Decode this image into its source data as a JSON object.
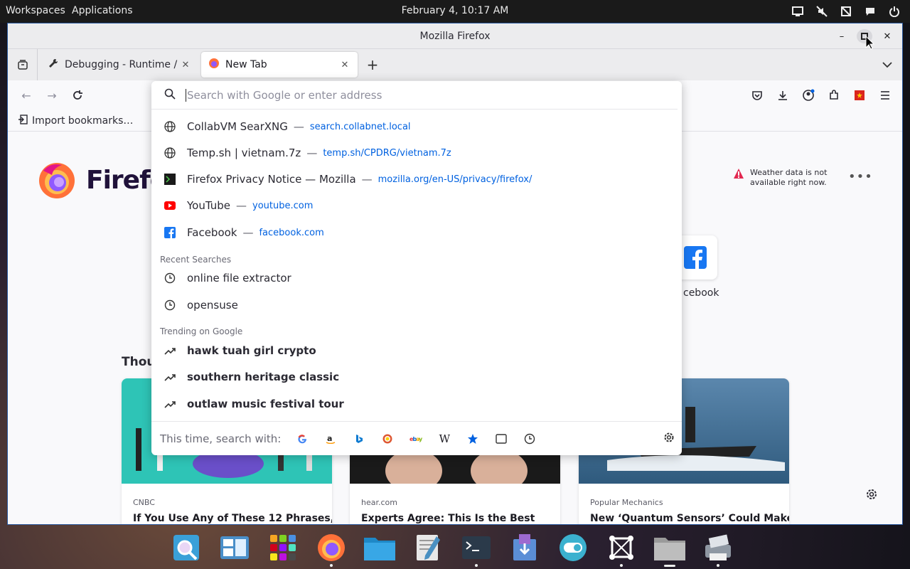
{
  "top_panel": {
    "workspaces": "Workspaces",
    "applications": "Applications",
    "clock": "February 4, 10:17 AM",
    "tray_icons": [
      "display-icon",
      "mute-icon",
      "network-off-icon",
      "chat-icon",
      "power-icon"
    ]
  },
  "window": {
    "title": "Mozilla Firefox",
    "controls": [
      "minimize",
      "maximize",
      "close"
    ]
  },
  "tabs": [
    {
      "label": "Debugging - Runtime / this-firefox",
      "icon": "wrench-icon",
      "active": false
    },
    {
      "label": "New Tab",
      "icon": "firefox-icon",
      "active": true
    }
  ],
  "navbar": {
    "url_placeholder": "Search with Google or enter address",
    "toolbar_icons": [
      "pocket-icon",
      "download-icon",
      "account-icon",
      "extensions-icon",
      "flag-icon",
      "menu-icon"
    ]
  },
  "bookmarks": {
    "import_label": "Import bookmarks…"
  },
  "newtab": {
    "brand": "Firefox",
    "weather_message": "Weather data is not available right now.",
    "shortcut_label": "cebook",
    "stories_heading": "Thou",
    "cards": [
      {
        "source": "CNBC",
        "headline": "If You Use Any of These 12 Phrases,",
        "color": "#2ec4b6"
      },
      {
        "source": "hear.com",
        "headline": "Experts Agree: This Is the Best",
        "color": "#1a1a1a"
      },
      {
        "source": "Popular Mechanics",
        "headline": "New ‘Quantum Sensors’ Could Make",
        "color": "#3f6e94"
      }
    ]
  },
  "suggestions": {
    "sites": [
      {
        "title": "CollabVM SearXNG",
        "url": "search.collabnet.local",
        "icon": "globe-icon"
      },
      {
        "title": "Temp.sh | vietnam.7z",
        "url": "temp.sh/CPDRG/vietnam.7z",
        "icon": "globe-icon"
      },
      {
        "title": "Firefox Privacy Notice — Mozilla",
        "url": "mozilla.org/en-US/privacy/firefox/",
        "icon": "terminal-favicon-icon"
      },
      {
        "title": "YouTube",
        "url": "youtube.com",
        "icon": "youtube-icon"
      },
      {
        "title": "Facebook",
        "url": "facebook.com",
        "icon": "facebook-icon"
      }
    ],
    "separator": "—",
    "recent_label": "Recent Searches",
    "recent": [
      "online file extractor",
      "opensuse"
    ],
    "trending_label": "Trending on Google",
    "trending": [
      "hawk tuah girl crypto",
      "southern heritage classic",
      "outlaw music festival tour"
    ],
    "engines_label": "This time, search with:",
    "engines": [
      "google-icon",
      "amazon-icon",
      "bing-icon",
      "duckduckgo-icon",
      "ebay-icon",
      "wikipedia-icon",
      "bookmarks-star-icon",
      "tabs-icon",
      "history-icon"
    ]
  },
  "dock": {
    "apps": [
      "search-app-icon",
      "workspaces-app-icon",
      "app-grid-icon",
      "firefox-icon",
      "files-icon",
      "text-editor-icon",
      "terminal-icon",
      "installer-icon",
      "toggle-app-icon",
      "screenshot-app-icon",
      "folder-icon",
      "printer-icon"
    ]
  },
  "colors": {
    "accent": "#0061e0",
    "window_border": "#2b5aa0",
    "panel_bg": "#1a1a1a"
  }
}
